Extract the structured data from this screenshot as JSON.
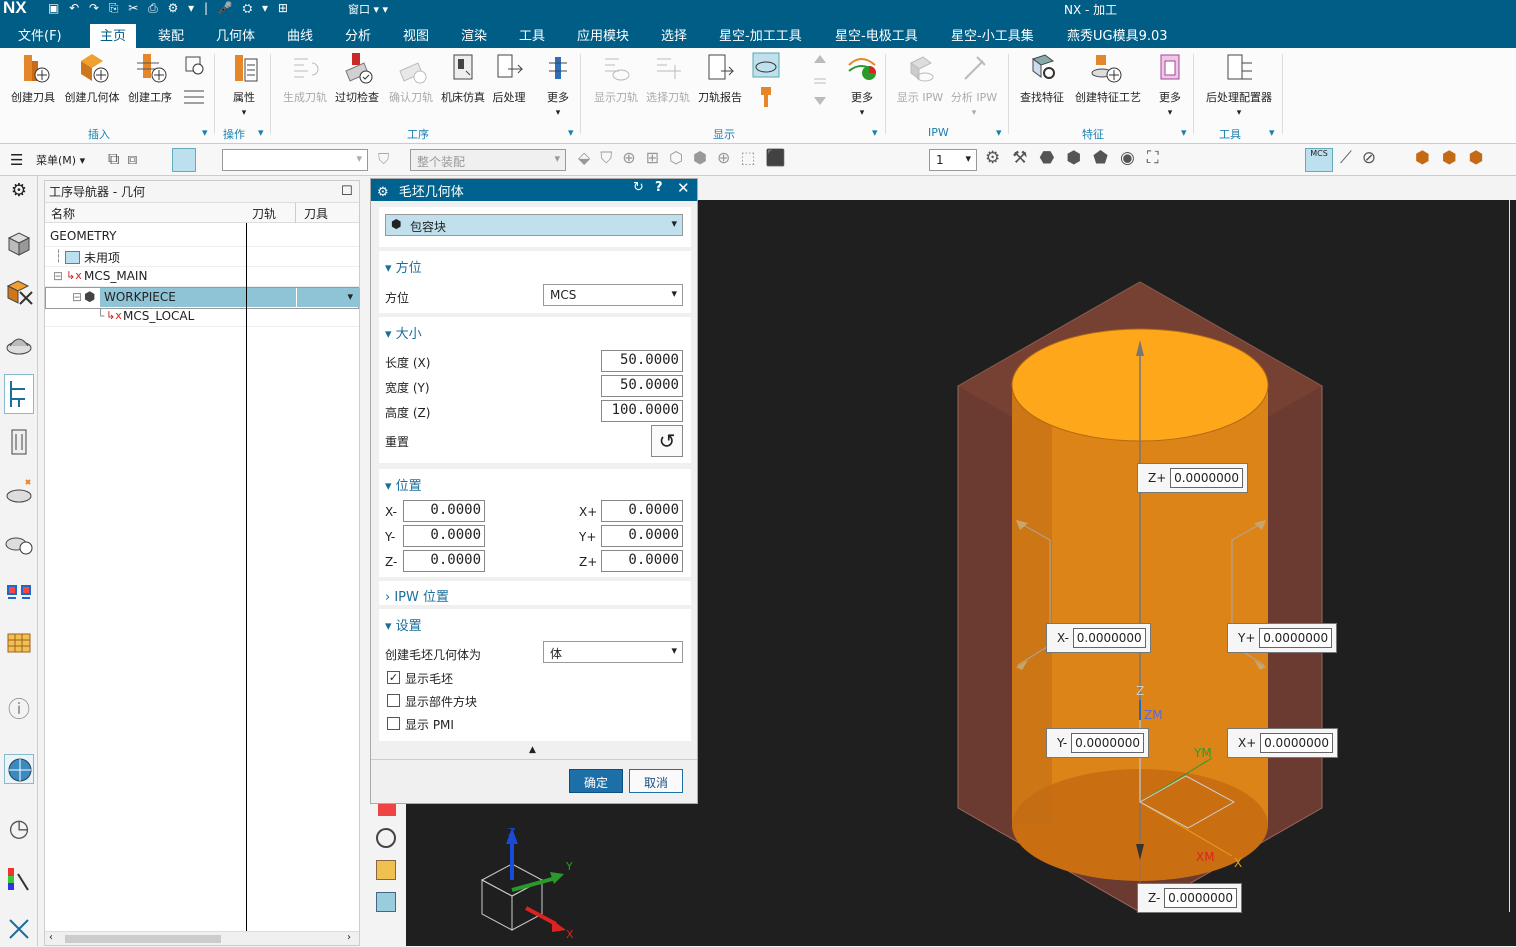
{
  "window": {
    "logo": "NX",
    "title": "NX - 加工",
    "window_menu": "窗口"
  },
  "menu": {
    "file": "文件(F)",
    "items": [
      "主页",
      "装配",
      "几何体",
      "曲线",
      "分析",
      "视图",
      "渲染",
      "工具",
      "应用模块",
      "选择",
      "星空-加工工具",
      "星空-电极工具",
      "星空-小工具集",
      "燕秀UG模具9.03"
    ]
  },
  "ribbon": {
    "buttons": [
      "创建刀具",
      "创建几何体",
      "创建工序",
      "属性",
      "生成刀轨",
      "过切检查",
      "确认刀轨",
      "机床仿真",
      "后处理",
      "更多",
      "显示刀轨",
      "选择刀轨",
      "刀轨报告",
      "更多",
      "显示 IPW",
      "分析 IPW",
      "查找特征",
      "创建特征工艺",
      "更多",
      "后处理配置器"
    ],
    "groups": [
      "插入",
      "操作",
      "工序",
      "显示",
      "IPW",
      "特征",
      "工具"
    ]
  },
  "toolbar2": {
    "menu_label": "菜单(M)",
    "assembly_placeholder": "整个装配",
    "layer_value": "1"
  },
  "navigator": {
    "title": "工序导航器 - 几何",
    "columns": [
      "名称",
      "刀轨",
      "刀具"
    ],
    "rows": [
      "GEOMETRY",
      "未用项",
      "MCS_MAIN",
      "WORKPIECE",
      "MCS_LOCAL"
    ]
  },
  "dialog": {
    "title": "毛坯几何体",
    "type": "包容块",
    "orientation": {
      "section": "方位",
      "label": "方位",
      "value": "MCS"
    },
    "size": {
      "section": "大小",
      "length_label": "长度 (X)",
      "length": "50.0000",
      "width_label": "宽度 (Y)",
      "width": "50.0000",
      "height_label": "高度 (Z)",
      "height": "100.0000",
      "reset_label": "重置"
    },
    "position": {
      "section": "位置",
      "xm_label": "X-",
      "xm": "0.0000",
      "ym_label": "Y-",
      "ym": "0.0000",
      "zm_label": "Z-",
      "zm": "0.0000",
      "xp_label": "X+",
      "xp": "0.0000",
      "yp_label": "Y+",
      "yp": "0.0000",
      "zp_label": "Z+",
      "zp": "0.0000"
    },
    "ipw": {
      "section": "IPW 位置"
    },
    "settings": {
      "section": "设置",
      "create_as_label": "创建毛坯几何体为",
      "create_as_value": "体",
      "show_blank": "显示毛坯",
      "show_blank_checked": true,
      "show_block": "显示部件方块",
      "show_block_checked": false,
      "show_pmi": "显示 PMI",
      "show_pmi_checked": false
    },
    "ok": "确定",
    "cancel": "取消"
  },
  "viewport": {
    "handles": {
      "zp_label": "Z+",
      "zp": "0.0000000",
      "zm_label": "Z-",
      "zm": "0.0000000",
      "xm_label": "X-",
      "xm": "0.0000000",
      "xp_label": "X+",
      "xp": "0.0000000",
      "yp_label": "Y+",
      "yp": "0.0000000",
      "ym_label": "Y-",
      "ym": "0.0000000"
    },
    "axis_labels": {
      "z": "Z",
      "zm": "ZM",
      "ym": "YM",
      "xm": "XM",
      "x": "X",
      "triad_z": "Z",
      "triad_y": "Y",
      "triad_x": "X"
    }
  },
  "colors": {
    "brand": "#005d86",
    "cylinder": "#e08a1e",
    "cylinder_top": "#ffa71a",
    "block": "#7a3c2c",
    "selection": "#8ec4d6"
  }
}
